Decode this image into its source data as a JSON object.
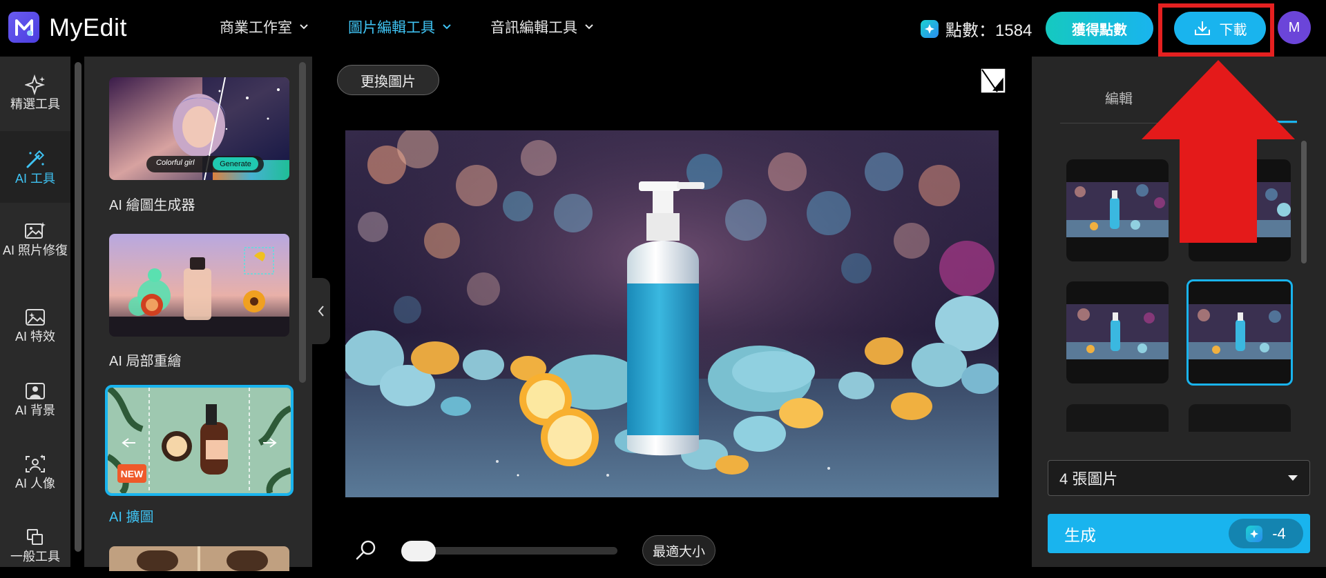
{
  "app": {
    "name": "MyEdit"
  },
  "nav": {
    "items": [
      {
        "label": "商業工作室",
        "active": false
      },
      {
        "label": "圖片編輯工具",
        "active": true
      },
      {
        "label": "音訊編輯工具",
        "active": false
      }
    ]
  },
  "account": {
    "points_label": "點數：1584",
    "get_points_label": "獲得點數",
    "download_label": "下載",
    "avatar_initial": "M"
  },
  "rail": {
    "items": [
      {
        "label": "精選工具",
        "icon": "sparkles-icon",
        "active": false
      },
      {
        "label": "AI 工具",
        "icon": "magic-wand-icon",
        "active": true
      },
      {
        "label": "AI 照片修復",
        "icon": "photo-repair-icon",
        "active": false
      },
      {
        "label": "AI 特效",
        "icon": "effects-icon",
        "active": false
      },
      {
        "label": "AI 背景",
        "icon": "background-icon",
        "active": false
      },
      {
        "label": "AI 人像",
        "icon": "portrait-icon",
        "active": false
      },
      {
        "label": "一般工具",
        "icon": "layers-icon",
        "active": false
      }
    ]
  },
  "tools": {
    "items": [
      {
        "label": "AI 繪圖生成器",
        "active": false
      },
      {
        "label": "AI 局部重繪",
        "active": false
      },
      {
        "label": "AI 擴圖",
        "active": true,
        "badge": "NEW"
      }
    ],
    "card1_caption": "Colorful girl",
    "card1_button": "Generate"
  },
  "canvas": {
    "replace_label": "更換圖片",
    "fit_label": "最適大小",
    "zoom_level": 0.0
  },
  "right": {
    "tab_edit": "編輯",
    "results_count": 4,
    "selected_index": 3,
    "count_select": "4 張圖片",
    "generate_label": "生成",
    "generate_cost": "-4"
  },
  "colors": {
    "accent": "#19b4ee",
    "highlight_red": "#e52020",
    "brand_purple": "#5a4ee8"
  }
}
